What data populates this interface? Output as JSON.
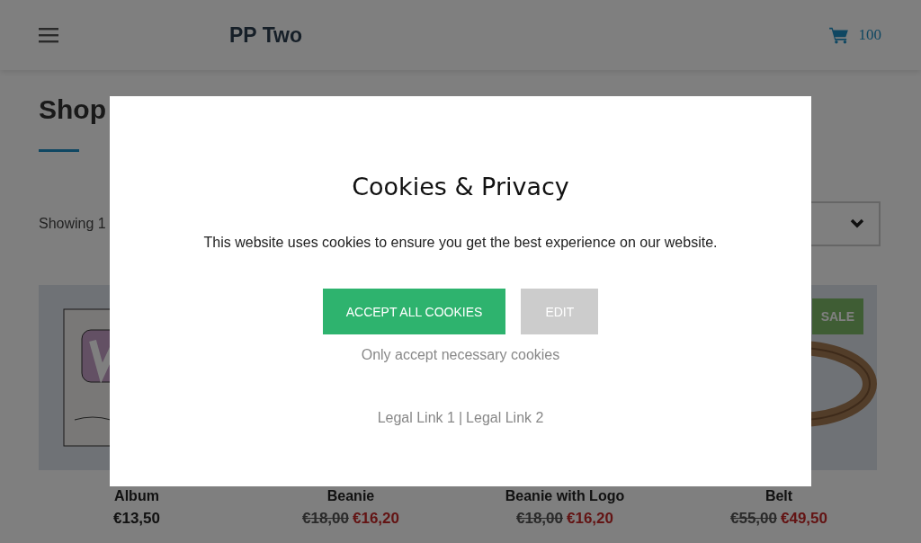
{
  "header": {
    "logo": "PP Two",
    "cart_count": "100"
  },
  "shop": {
    "title": "Shop",
    "result_count": "Showing 1"
  },
  "products": [
    {
      "name": "Album",
      "price": "€13,50"
    },
    {
      "name": "Beanie",
      "old_price": "€18,00",
      "price": "€16,20"
    },
    {
      "name": "Beanie with Logo",
      "old_price": "€18,00",
      "price": "€16,20"
    },
    {
      "name": "Belt",
      "old_price": "€55,00",
      "price": "€49,50",
      "badge": "SALE"
    }
  ],
  "cookie_dialog": {
    "title": "Cookies & Privacy",
    "message": "This website uses cookies to ensure you get the best experience on our website.",
    "buttons": [
      {
        "label": "ACCEPT ALL COOKIES",
        "kind": "primary"
      },
      {
        "label": "EDIT",
        "kind": "secondary"
      }
    ],
    "necessary_link": "Only accept necessary cookies",
    "legal_links": [
      "Legal Link 1",
      "Legal Link 2"
    ],
    "separator": "|"
  }
}
